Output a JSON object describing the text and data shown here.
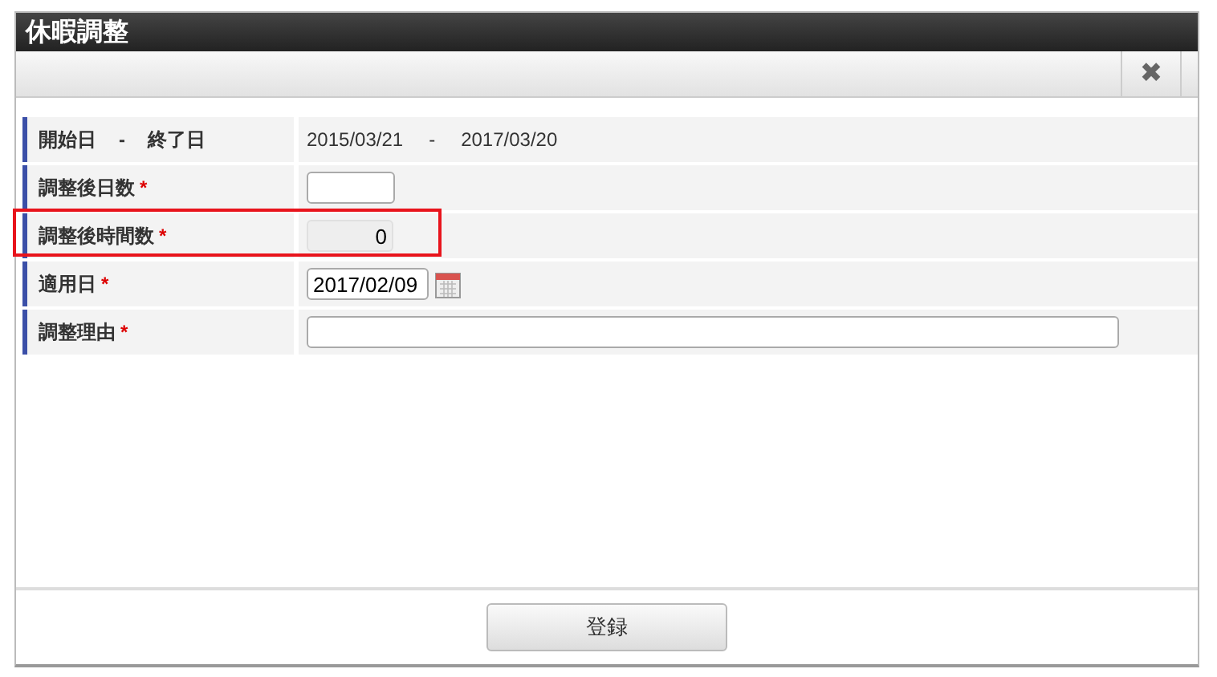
{
  "dialog": {
    "title": "休暇調整",
    "close_icon": "✖"
  },
  "rows": [
    {
      "kind": "range",
      "label_parts": [
        "開始日",
        "-",
        "終了日"
      ],
      "required": false,
      "highlighted": false,
      "value_parts": [
        "2015/03/21",
        "-",
        "2017/03/20"
      ]
    },
    {
      "kind": "input",
      "label": "調整後日数",
      "required": true,
      "highlighted": false
    },
    {
      "kind": "readonly",
      "label": "調整後時間数",
      "required": true,
      "highlighted": true,
      "value": "0"
    },
    {
      "kind": "date",
      "label": "適用日",
      "required": true,
      "highlighted": false,
      "value": "2017/02/09"
    },
    {
      "kind": "text",
      "label": "調整理由",
      "required": true,
      "highlighted": false
    }
  ],
  "required_mark": "*",
  "footer": {
    "button": "登録"
  }
}
